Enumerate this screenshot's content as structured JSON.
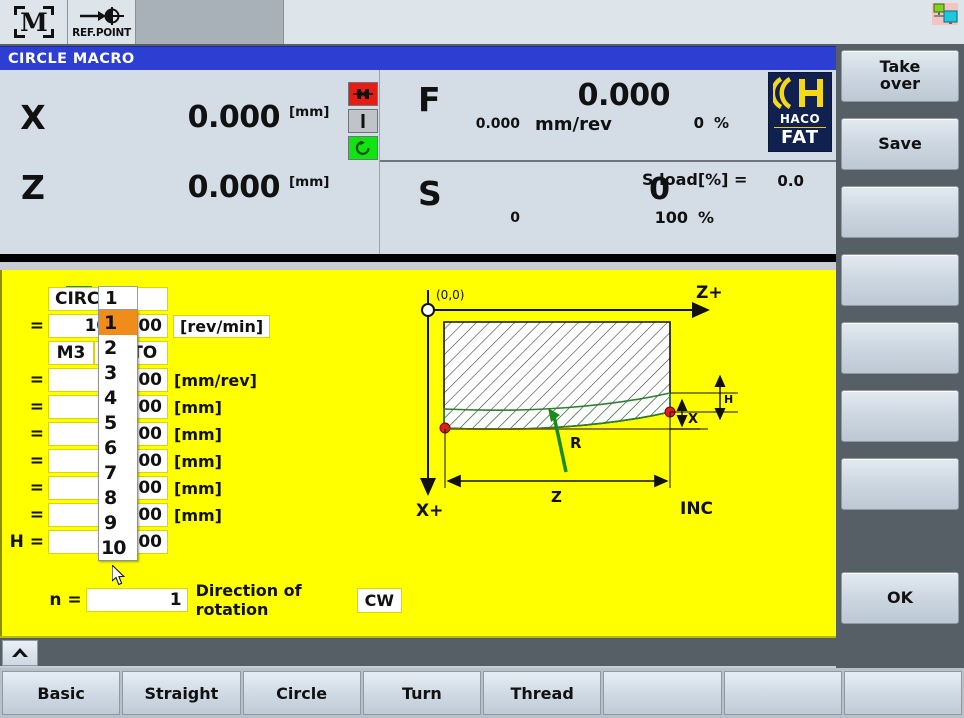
{
  "topbar": {
    "tabs": [
      {
        "icon": "machine-mode-icon",
        "label": ""
      },
      {
        "icon": "ref-point-icon",
        "label": "REF.POINT"
      }
    ],
    "network_icon": "network-status-icon"
  },
  "title": "CIRCLE MACRO",
  "dro": {
    "axes": [
      {
        "name": "X",
        "value": "0.000",
        "unit": "[mm]"
      },
      {
        "name": "Z",
        "value": "0.000",
        "unit": "[mm]"
      }
    ],
    "status_icons": [
      {
        "name": "chuck-clamp-icon",
        "color": "#e71d14"
      },
      {
        "name": "tailstock-icon",
        "color": "#c0c4c8"
      },
      {
        "name": "spindle-rotation-icon",
        "color": "#11e511"
      }
    ],
    "feed": {
      "letter": "F",
      "actual": "0.000",
      "programmed": "0.000",
      "unit": "mm/rev",
      "override": "0",
      "override_symbol": "%"
    },
    "spindle": {
      "letter": "S",
      "actual": "0",
      "programmed": "0",
      "load_label": "S load[%] =",
      "load_value": "0.0",
      "override": "100",
      "override_symbol": "%"
    },
    "logo": {
      "brand": "HACO",
      "sub": "FAT"
    }
  },
  "form": {
    "macro_icon": "circle-macro-icon",
    "dropdown": {
      "selected": "1",
      "options": [
        "1",
        "2",
        "3",
        "4",
        "5",
        "6",
        "7",
        "8",
        "9",
        "10"
      ]
    },
    "rows": [
      {
        "label": "",
        "value": "CIRCLE1",
        "align": "left",
        "unit": "",
        "unit_boxed": false
      },
      {
        "label": "=",
        "value": "100.000",
        "align": "right",
        "unit": "[rev/min]",
        "unit_boxed": true
      },
      {
        "label": "",
        "value": "",
        "align": "split",
        "left": "M3",
        "right": "AUTO",
        "unit": "",
        "unit_boxed": false
      },
      {
        "label": "=",
        "value": "1.000",
        "align": "right",
        "unit": "[mm/rev]",
        "unit_boxed": false
      },
      {
        "label": "=",
        "value": "0.000",
        "align": "right",
        "unit": "[mm]",
        "unit_boxed": false
      },
      {
        "label": "=",
        "value": "0.000",
        "align": "right",
        "unit": "[mm]",
        "unit_boxed": false
      },
      {
        "label": "=",
        "value": "0.000",
        "align": "right",
        "unit": "[mm]",
        "unit_boxed": false
      },
      {
        "label": "=",
        "value": "0.000",
        "align": "right",
        "unit": "[mm]",
        "unit_boxed": false
      },
      {
        "label": "=",
        "value": "1.000",
        "align": "right",
        "unit": "[mm]",
        "unit_boxed": false
      },
      {
        "label": "H =",
        "value": "1.000",
        "align": "right",
        "unit": "",
        "unit_boxed": false
      }
    ],
    "rotation": {
      "count_label": "n =",
      "count_value": "1",
      "direction_label": "Direction of rotation",
      "direction_value": "CW"
    }
  },
  "diagram": {
    "origin_label": "(0,0)",
    "z_axis_label": "Z+",
    "x_axis_label": "X+",
    "radius_label": "R",
    "z_dim_label": "Z",
    "x_dim_label": "X",
    "h_dim_label": "H",
    "mode_label": "INC"
  },
  "softkeys": {
    "right": [
      "Take\nover",
      "Save",
      "",
      "",
      "",
      "",
      "",
      "OK"
    ],
    "right_flat": [
      "Take over",
      "Save",
      "",
      "",
      "",
      "",
      "",
      "OK"
    ],
    "bottom": [
      "Basic",
      "Straight",
      "Circle",
      "Turn",
      "Thread",
      "",
      "",
      ""
    ]
  },
  "collapse_icon": "chevron-up-icon",
  "colors": {
    "title_bar": "#2c3fd2",
    "work_area": "#ffff00",
    "selection": "#f08c1a",
    "accent_green": "#11e511",
    "accent_red": "#e71d14",
    "logo_navy": "#10214f",
    "logo_yellow": "#f5d916"
  }
}
